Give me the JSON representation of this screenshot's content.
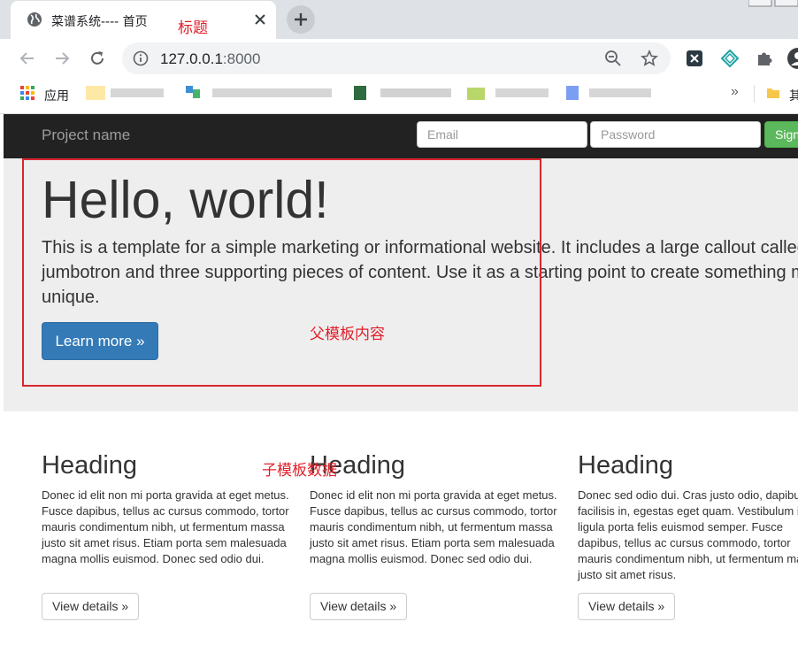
{
  "browser": {
    "tab_title": "菜谱系统---- 首页",
    "url_host": "127.0.0.1",
    "url_port": ":8000",
    "bookmarks": {
      "apps_label": "应用",
      "more": "»",
      "folder_label": "其"
    }
  },
  "navbar": {
    "brand": "Project name",
    "email_placeholder": "Email",
    "password_placeholder": "Password",
    "signin_label": "Sign in"
  },
  "jumbotron": {
    "title": "Hello, world!",
    "text": "This is a template for a simple marketing or informational website. It includes a large callout called a jumbotron and three supporting pieces of content. Use it as a starting point to create something more unique.",
    "button": "Learn more »"
  },
  "columns": [
    {
      "heading": "Heading",
      "text": "Donec id elit non mi porta gravida at eget metus. Fusce dapibus, tellus ac cursus commodo, tortor mauris condimentum nibh, ut fermentum massa justo sit amet risus. Etiam porta sem malesuada magna mollis euismod. Donec sed odio dui.",
      "button": "View details »"
    },
    {
      "heading": "Heading",
      "text": "Donec id elit non mi porta gravida at eget metus. Fusce dapibus, tellus ac cursus commodo, tortor mauris condimentum nibh, ut fermentum massa justo sit amet risus. Etiam porta sem malesuada magna mollis euismod. Donec sed odio dui.",
      "button": "View details »"
    },
    {
      "heading": "Heading",
      "text": "Donec sed odio dui. Cras justo odio, dapibus ac facilisis in, egestas eget quam. Vestibulum id ligula porta felis euismod semper. Fusce dapibus, tellus ac cursus commodo, tortor mauris condimentum nibh, ut fermentum massa justo sit amet risus.",
      "button": "View details »"
    }
  ],
  "annotations": {
    "title_note": "标题",
    "parent_note": "父模板内容",
    "child_note": "子模板数据"
  },
  "colors": {
    "annotation": "#e0202a",
    "navbar": "#222222",
    "jumbotron": "#eeeeee",
    "primary": "#337ab7",
    "success": "#5cb85c"
  }
}
